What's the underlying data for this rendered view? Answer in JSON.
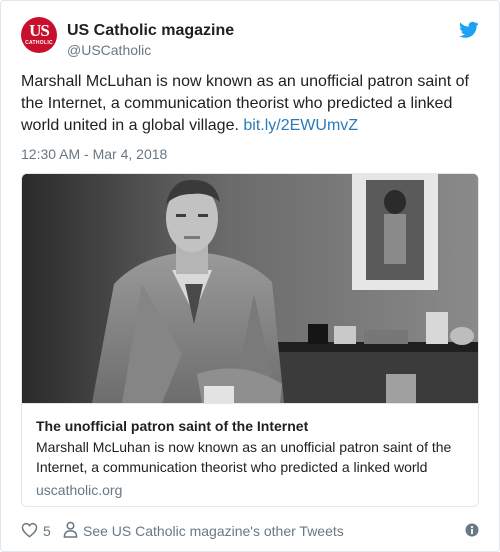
{
  "author": {
    "display_name": "US Catholic magazine",
    "handle": "@USCatholic",
    "avatar_text": "US",
    "avatar_subtext": "CATHOLIC"
  },
  "tweet": {
    "text": "Marshall McLuhan is now known as an unofficial patron saint of the Internet, a communication theorist who predicted a linked world united in a global village.",
    "link_text": "bit.ly/2EWUmvZ",
    "timestamp": "12:30 AM - Mar 4, 2018"
  },
  "card": {
    "image_icon": "photo-of-man-in-suit",
    "title": "The unofficial patron saint of the Internet",
    "description": "Marshall McLuhan is now known as an unofficial patron saint of the Internet, a communication theorist who predicted a linked world",
    "domain": "uscatholic.org"
  },
  "footer": {
    "like_count": "5",
    "other_tweets_label": "See US Catholic magazine's other Tweets",
    "icons": [
      "heart-icon",
      "person-icon",
      "info-icon"
    ]
  },
  "colors": {
    "twitter_blue": "#1da1f2",
    "link_blue": "#2b7bb9",
    "avatar_red": "#c8102e",
    "secondary_text": "#697882"
  }
}
